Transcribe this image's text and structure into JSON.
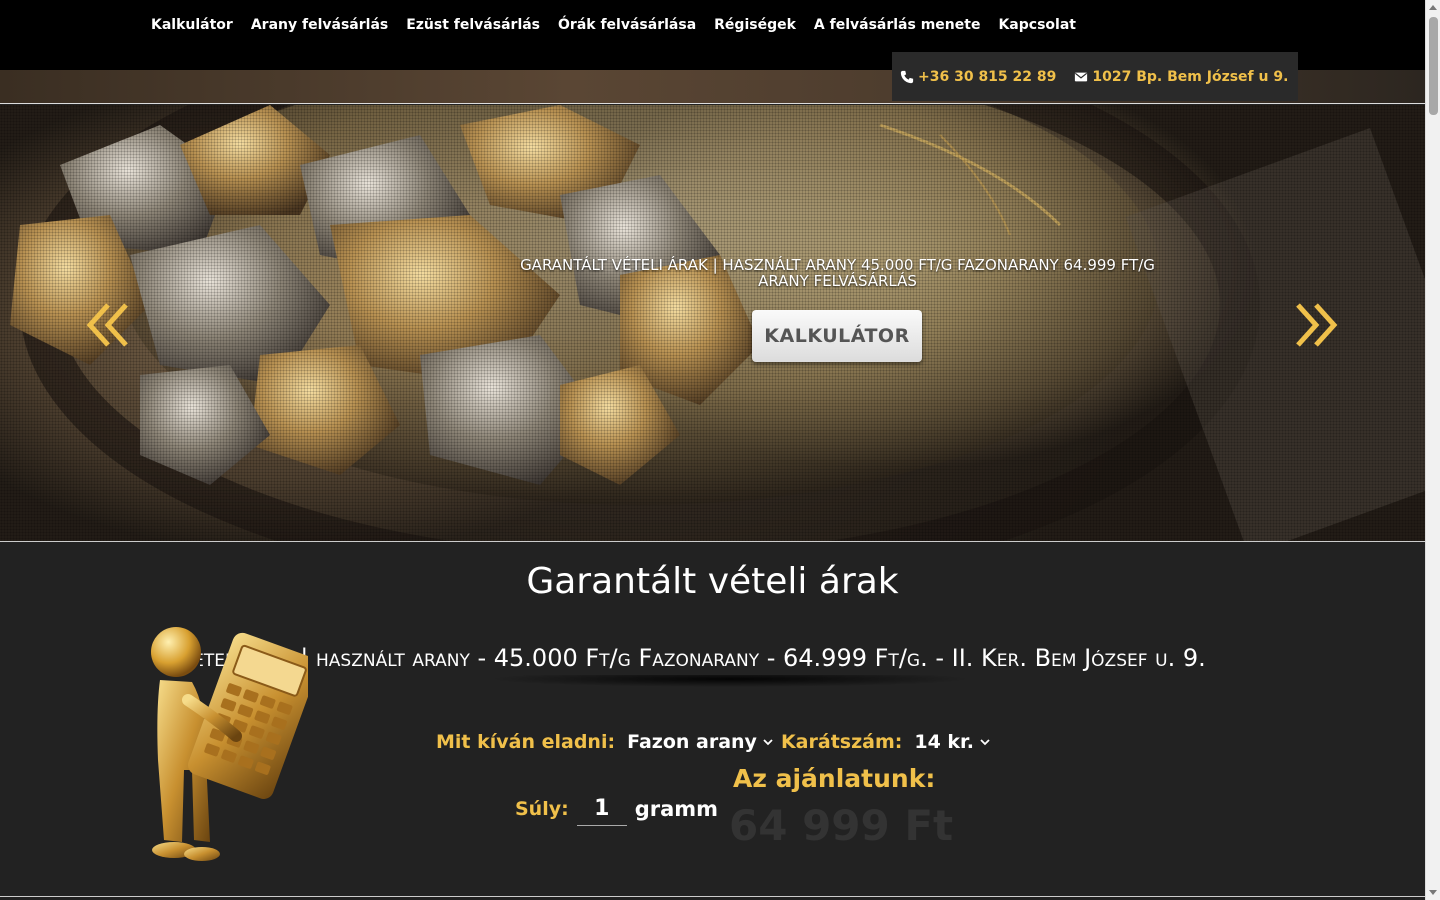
{
  "nav": {
    "items": [
      {
        "label": "Kalkulátor"
      },
      {
        "label": "Arany felvásárlás"
      },
      {
        "label": "Ezüst felvásárlás"
      },
      {
        "label": "Órák felvásárlása"
      },
      {
        "label": "Régiségek"
      },
      {
        "label": "A felvásárlás menete"
      },
      {
        "label": "Kapcsolat"
      }
    ]
  },
  "contact": {
    "phone": "+36 30 815 22 89",
    "phone_icon": "phone-icon",
    "address": "1027 Bp. Bem József u 9.",
    "address_icon": "envelope-icon"
  },
  "hero": {
    "caption_line1": "Garantált vételi árak | használt arany 45.000 Ft/g Fazonarany 64.999 Ft/g",
    "caption_line2": "Arany felvásárlás",
    "button_label": "KALKULÁTOR",
    "prev_icon": "double-chevron-left-icon",
    "next_icon": "double-chevron-right-icon"
  },
  "prices": {
    "title": "Garantált vételi árak",
    "marquee": "Garantált vételi árak | használt arany - 45.000 Ft/g Fazonarany - 64.999 Ft/g. - II. Ker. Bem József u. 9."
  },
  "calculator": {
    "sell_label": "Mit kíván eladni:",
    "sell_value": "Fazon arany",
    "karat_label": "Karátszám:",
    "karat_value": "14 kr.",
    "weight_label": "Súly:",
    "weight_value": "1",
    "weight_unit": "gramm",
    "offer_label": "Az ajánlatunk:",
    "offer_value": "64 999 Ft"
  },
  "colors": {
    "accent": "#f0c04a",
    "nav_bg": "#000000",
    "section_bg": "#222222"
  }
}
